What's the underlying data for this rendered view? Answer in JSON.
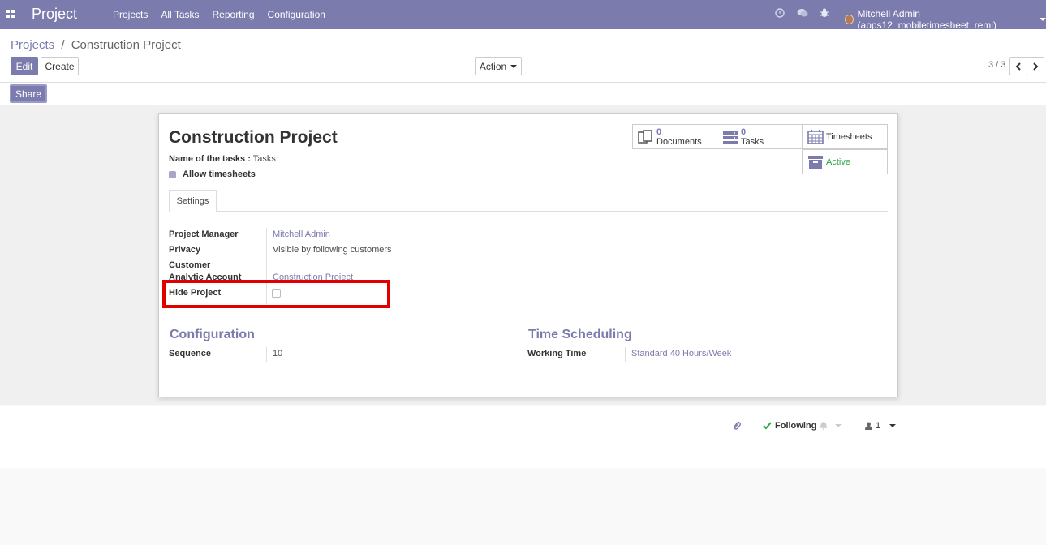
{
  "navbar": {
    "brand": "Project",
    "menu": [
      "Projects",
      "All Tasks",
      "Reporting",
      "Configuration"
    ],
    "user": "Mitchell Admin (apps12_mobiletimesheet_remi)"
  },
  "breadcrumb": {
    "parent": "Projects",
    "separator": "/",
    "current": "Construction Project"
  },
  "buttons": {
    "edit": "Edit",
    "create": "Create",
    "action": "Action",
    "share": "Share"
  },
  "pager": {
    "value": "3 / 3"
  },
  "form": {
    "title": "Construction Project",
    "tasks_name_label": "Name of the tasks :",
    "tasks_name_value": "Tasks",
    "allow_timesheets": "Allow timesheets",
    "allow_timesheets_checked": true,
    "tab": "Settings",
    "fields": {
      "project_manager_label": "Project Manager",
      "project_manager_value": "Mitchell Admin",
      "privacy_label": "Privacy",
      "privacy_value": "Visible by following customers",
      "customer_label": "Customer",
      "analytic_label": "Analytic Account",
      "analytic_value": "Construction Project",
      "hide_label": "Hide Project",
      "hide_checked": false
    },
    "configuration": {
      "title": "Configuration",
      "sequence_label": "Sequence",
      "sequence_value": "10"
    },
    "time_scheduling": {
      "title": "Time Scheduling",
      "working_time_label": "Working Time",
      "working_time_value": "Standard 40 Hours/Week"
    }
  },
  "smart_buttons": {
    "documents_count": "0",
    "documents_label": "Documents",
    "tasks_count": "0",
    "tasks_label": "Tasks",
    "timesheets_label": "Timesheets",
    "active_label": "Active",
    "active_color": "#28a745"
  },
  "chatter": {
    "following": "Following",
    "followers_count": "1"
  },
  "colors": {
    "brand": "#7c7bad",
    "highlight": "#e00000"
  }
}
